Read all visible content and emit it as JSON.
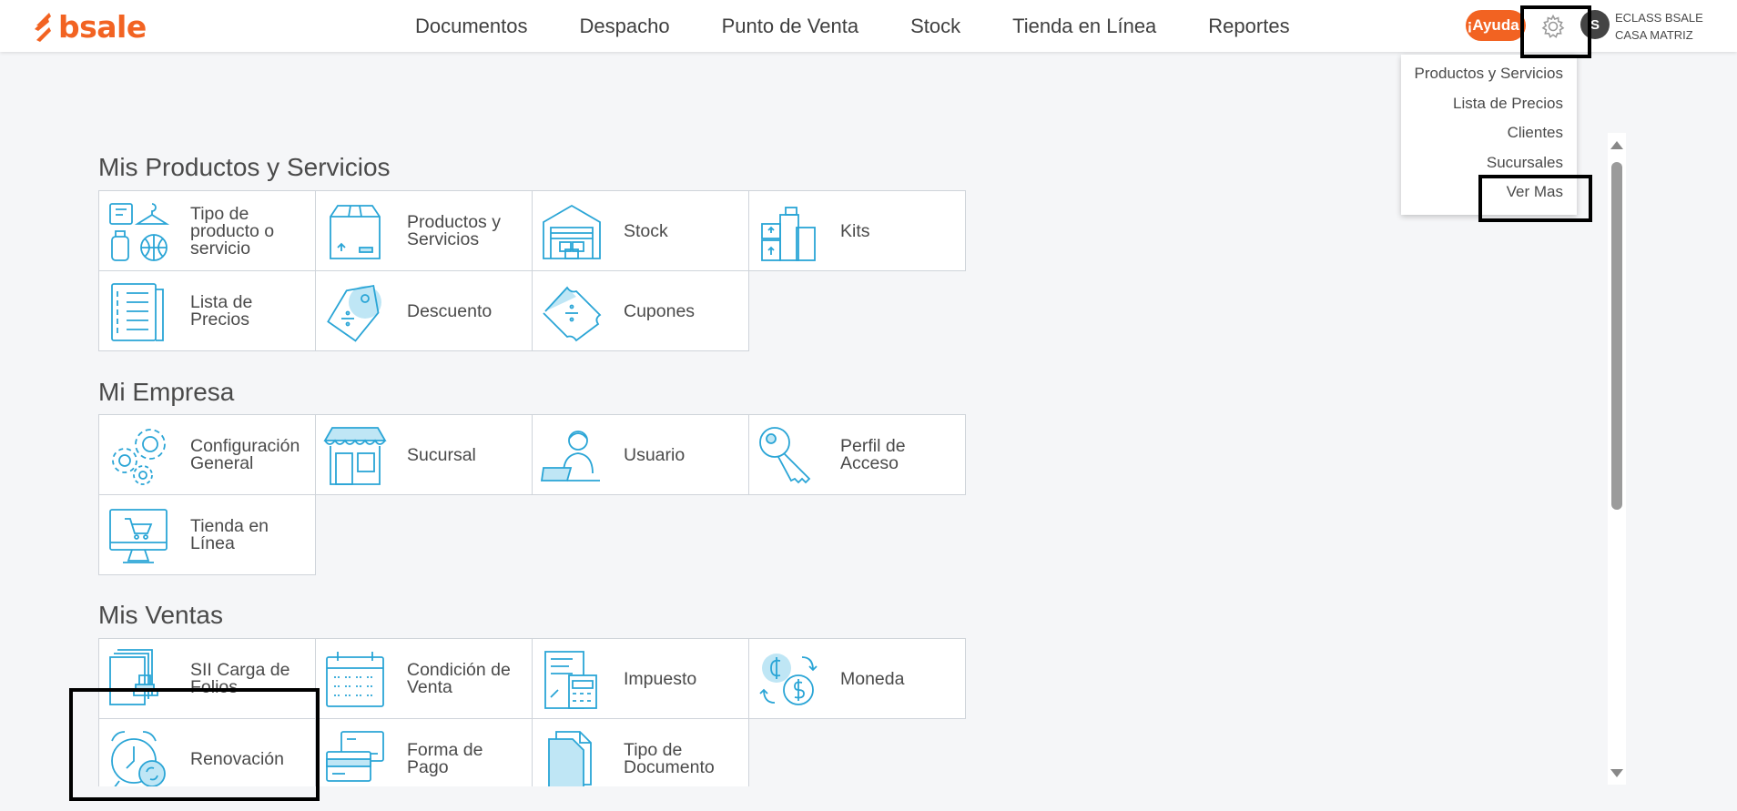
{
  "brand": {
    "name": "bsale",
    "color": "#f26322",
    "accent": "#39b5e0"
  },
  "nav": {
    "items": [
      "Documentos",
      "Despacho",
      "Punto de Venta",
      "Stock",
      "Tienda en Línea",
      "Reportes"
    ]
  },
  "header": {
    "help_label": "¡Ayuda!",
    "avatar_initial": "S",
    "account_line1": "ECLASS BSALE",
    "account_line2": "CASA MATRIZ"
  },
  "dropdown": {
    "items": [
      "Productos y Servicios",
      "Lista de Precios",
      "Clientes",
      "Sucursales",
      "Ver Mas"
    ]
  },
  "sections": [
    {
      "title": "Mis Productos y Servicios",
      "tiles": [
        {
          "label": "Tipo de producto o servicio",
          "icon": "product-types-icon"
        },
        {
          "label": "Productos y Servicios",
          "icon": "box-icon"
        },
        {
          "label": "Stock",
          "icon": "warehouse-icon"
        },
        {
          "label": "Kits",
          "icon": "kits-icon"
        },
        {
          "label": "Lista de Precios",
          "icon": "price-list-icon"
        },
        {
          "label": "Descuento",
          "icon": "discount-tag-icon"
        },
        {
          "label": "Cupones",
          "icon": "coupon-icon"
        }
      ]
    },
    {
      "title": "Mi Empresa",
      "tiles": [
        {
          "label": "Configuración General",
          "icon": "gears-icon"
        },
        {
          "label": "Sucursal",
          "icon": "store-icon"
        },
        {
          "label": "Usuario",
          "icon": "user-laptop-icon"
        },
        {
          "label": "Perfil de Acceso",
          "icon": "key-icon"
        },
        {
          "label": "Tienda en Línea",
          "icon": "online-store-icon"
        }
      ]
    },
    {
      "title": "Mis Ventas",
      "tiles": [
        {
          "label": "SII Carga de Folios",
          "icon": "stamp-icon"
        },
        {
          "label": "Condición de Venta",
          "icon": "calendar-icon"
        },
        {
          "label": "Impuesto",
          "icon": "tax-calculator-icon"
        },
        {
          "label": "Moneda",
          "icon": "currency-exchange-icon"
        },
        {
          "label": "Renovación",
          "icon": "alarm-clock-icon"
        },
        {
          "label": "Forma de Pago",
          "icon": "payment-cards-icon"
        },
        {
          "label": "Tipo de Documento",
          "icon": "document-icon"
        }
      ]
    }
  ]
}
